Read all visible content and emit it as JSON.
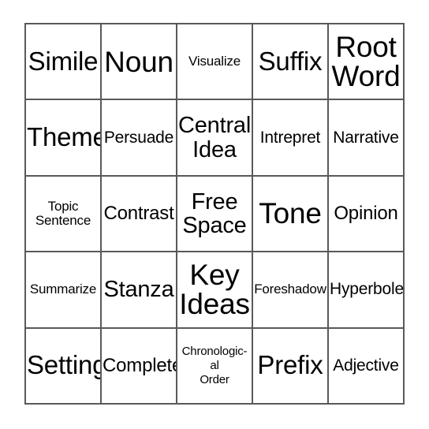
{
  "card": {
    "type": "bingo-card",
    "grid_size": "5x5",
    "free_space_index": 12,
    "border_color": "#58595b",
    "text_color": "#000000",
    "background_color": "#ffffff",
    "rows": [
      [
        {
          "label": "Simile",
          "size": "lg"
        },
        {
          "label": "Noun",
          "size": "xl"
        },
        {
          "label": "Visualize",
          "size": "xxs"
        },
        {
          "label": "Suffix",
          "size": "lg"
        },
        {
          "label": "Root\nWord",
          "size": "xl"
        }
      ],
      [
        {
          "label": "Theme",
          "size": "lg"
        },
        {
          "label": "Persuade",
          "size": "xs"
        },
        {
          "label": "Central\nIdea",
          "size": "md"
        },
        {
          "label": "Intrepret",
          "size": "xs"
        },
        {
          "label": "Narrative",
          "size": "xs"
        }
      ],
      [
        {
          "label": "Topic\nSentence",
          "size": "xxs"
        },
        {
          "label": "Contrast",
          "size": "sm"
        },
        {
          "label": "Free\nSpace",
          "size": "md"
        },
        {
          "label": "Tone",
          "size": "xl"
        },
        {
          "label": "Opinion",
          "size": "sm"
        }
      ],
      [
        {
          "label": "Summarize",
          "size": "xxs"
        },
        {
          "label": "Stanza",
          "size": "md"
        },
        {
          "label": "Key\nIdeas",
          "size": "xl"
        },
        {
          "label": "Foreshadow",
          "size": "xxs"
        },
        {
          "label": "Hyperbole",
          "size": "xs"
        }
      ],
      [
        {
          "label": "Setting",
          "size": "lg"
        },
        {
          "label": "Complete",
          "size": "sm"
        },
        {
          "label": "Chronologic-\nal\nOrder",
          "size": "tin"
        },
        {
          "label": "Prefix",
          "size": "lg"
        },
        {
          "label": "Adjective",
          "size": "xs"
        }
      ]
    ]
  }
}
